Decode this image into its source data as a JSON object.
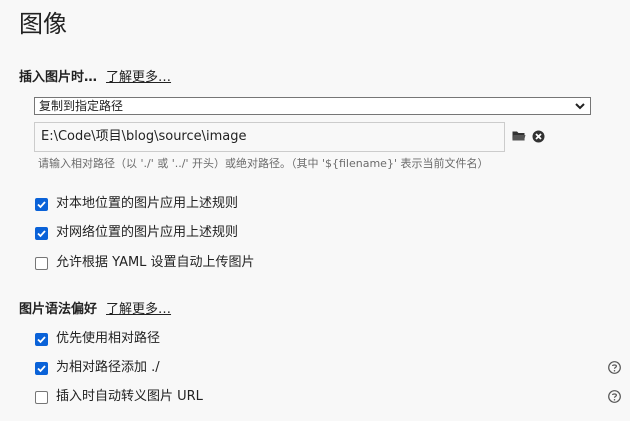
{
  "page": {
    "title": "图像"
  },
  "insert_section": {
    "header": "插入图片时…",
    "learn_more": "了解更多…",
    "action_select": {
      "selected": "复制到指定路径"
    },
    "path_input": {
      "value": "E:\\Code\\项目\\blog\\source\\image"
    },
    "hint": "请输入相对路径（以 './' 或 '../' 开头）或绝对路径。（其中 '${filename}' 表示当前文件名）",
    "options": [
      {
        "label": "对本地位置的图片应用上述规则",
        "checked": true
      },
      {
        "label": "对网络位置的图片应用上述规则",
        "checked": true
      },
      {
        "label": "允许根据 YAML 设置自动上传图片",
        "checked": false
      }
    ]
  },
  "syntax_section": {
    "header": "图片语法偏好",
    "learn_more": "了解更多…",
    "options": [
      {
        "label": "优先使用相对路径",
        "checked": true,
        "help": false
      },
      {
        "label": "为相对路径添加 ./",
        "checked": true,
        "help": true
      },
      {
        "label": "插入时自动转义图片 URL",
        "checked": false,
        "help": true
      }
    ]
  },
  "icons": {
    "folder": "folder-icon",
    "clear": "clear-icon",
    "help": "help-icon",
    "chevron": "chevron-down-icon",
    "check": "checkmark-icon"
  },
  "colors": {
    "background": "#f8f8f8",
    "checkbox_checked": "#0a62d8",
    "text": "#222222",
    "hint": "#6b6b6b"
  }
}
